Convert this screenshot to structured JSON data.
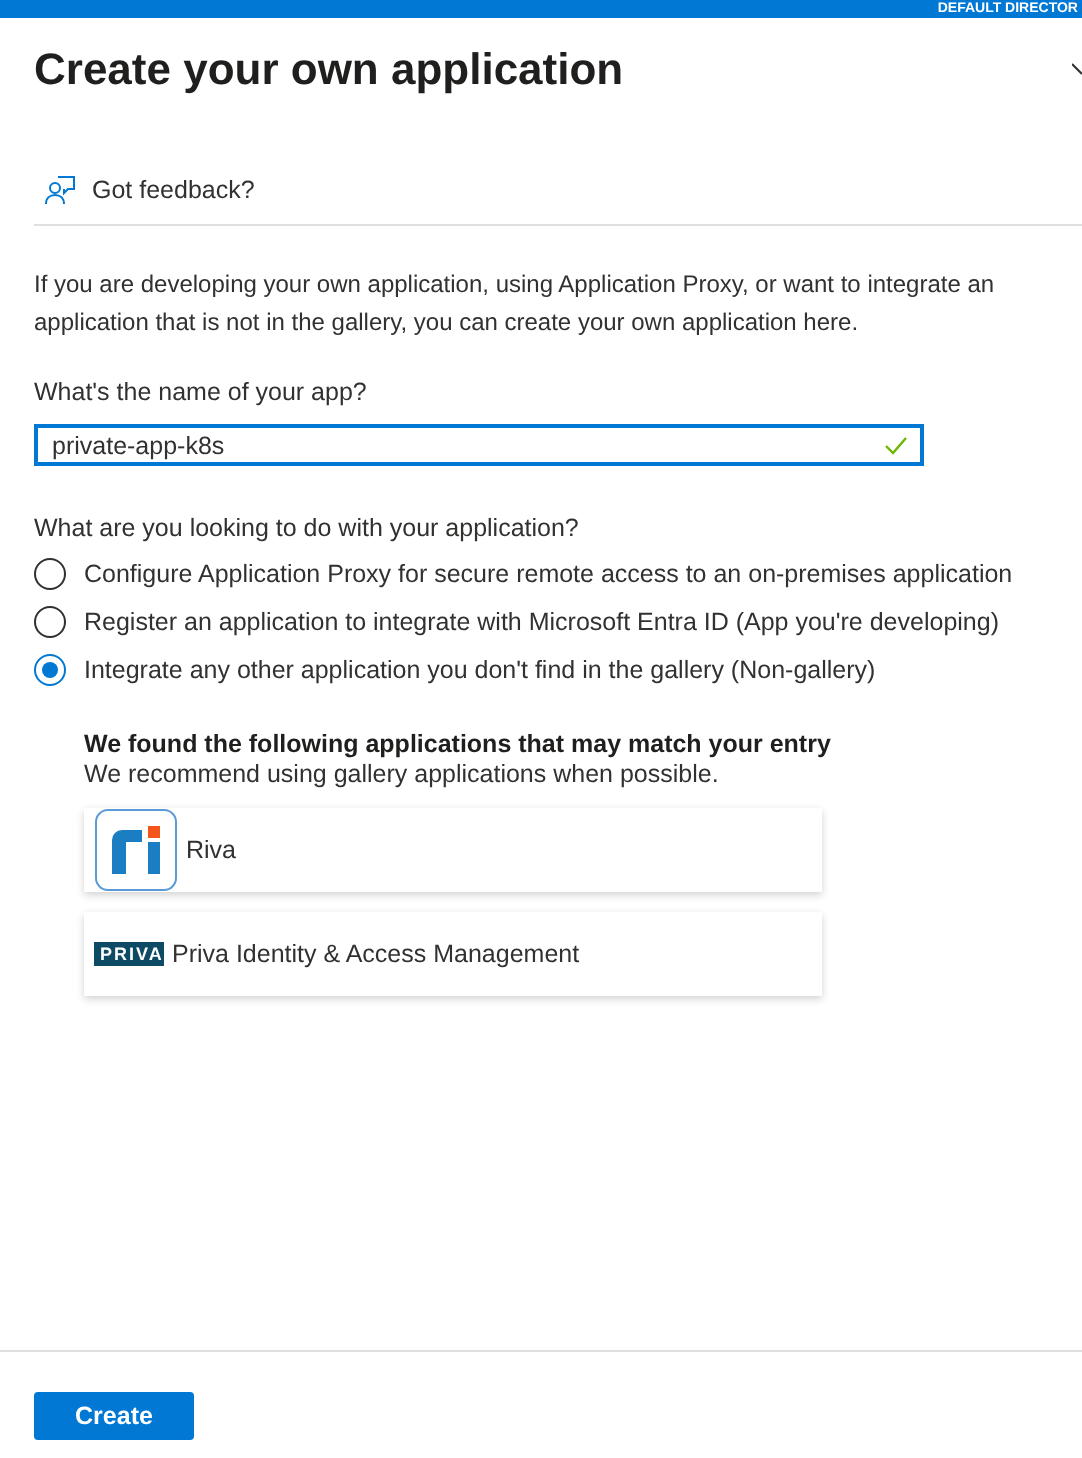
{
  "top_bar": {
    "directory": "DEFAULT DIRECTOR"
  },
  "title": "Create your own application",
  "feedback": "Got feedback?",
  "intro_lines": [
    "If you are developing your own application, using Application Proxy, or want to integrate an",
    "application that is not in the gallery, you can create your own application here."
  ],
  "name_field": {
    "label": "What's the name of your app?",
    "value": "private-app-k8s",
    "valid": true
  },
  "purpose": {
    "label": "What are you looking to do with your application?",
    "options": [
      {
        "label": "Configure Application Proxy for secure remote access to an on-premises application",
        "selected": false
      },
      {
        "label": "Register an application to integrate with Microsoft Entra ID (App you're developing)",
        "selected": false
      },
      {
        "label": "Integrate any other application you don't find in the gallery (Non-gallery)",
        "selected": true
      }
    ]
  },
  "matches": {
    "heading": "We found the following applications that may match your entry",
    "subheading": "We recommend using gallery applications when possible.",
    "apps": [
      {
        "kind": "ri",
        "name": "Riva"
      },
      {
        "kind": "wordmark",
        "logo_text": "PRIVA",
        "name": "Priva Identity & Access Management"
      }
    ]
  },
  "create_button": "Create"
}
